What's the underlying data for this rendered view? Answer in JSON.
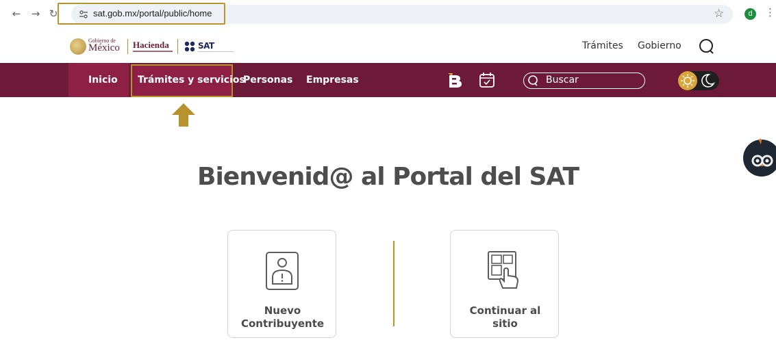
{
  "browser": {
    "url": "sat.gob.mx/portal/public/home",
    "back_icon": "←",
    "forward_icon": "→",
    "reload_icon": "↻",
    "star_icon": "☆",
    "profile_initial": "d",
    "menu_icon": "⋮"
  },
  "header": {
    "gob_small": "Gobierno de",
    "gob_big": "México",
    "hacienda": "Hacienda",
    "sat": "SAT",
    "top_links": [
      "Trámites",
      "Gobierno"
    ]
  },
  "nav": {
    "items": [
      "Inicio",
      "Trámites y servicios",
      "Personas",
      "Empresas"
    ],
    "search_placeholder": "Buscar"
  },
  "main": {
    "title": "Bienvenid@ al Portal del SAT",
    "cards": [
      {
        "label_line1": "Nuevo",
        "label_line2": "Contribuyente"
      },
      {
        "label_line1": "Continuar al",
        "label_line2": "sitio"
      }
    ]
  },
  "colors": {
    "nav_bg": "#6d1a39",
    "accent_gold": "#b8922c",
    "title_gray": "#4d4d4d"
  }
}
